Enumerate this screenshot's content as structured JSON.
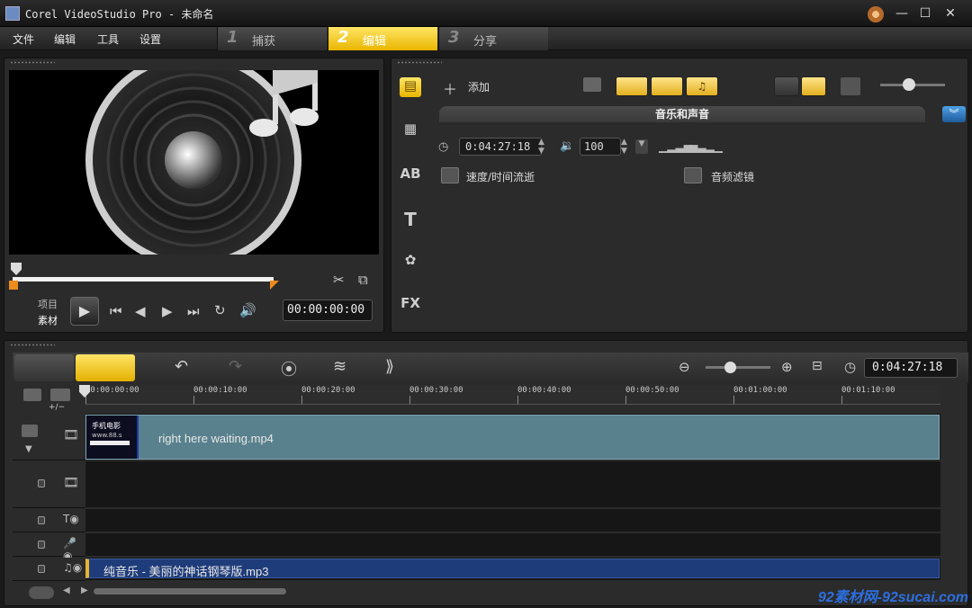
{
  "window": {
    "title": "Corel VideoStudio Pro - 未命名",
    "min": "—",
    "max": "☐",
    "close": "✕"
  },
  "menu": [
    "文件",
    "编辑",
    "工具",
    "设置"
  ],
  "steps": [
    {
      "num": "1",
      "label": "捕获"
    },
    {
      "num": "2",
      "label": "编辑"
    },
    {
      "num": "3",
      "label": "分享"
    }
  ],
  "preview": {
    "mode_project": "项目",
    "mode_clip": "素材",
    "timecode": "00:00:00:00"
  },
  "library": {
    "add_label": "添加",
    "header": "音乐和声音",
    "duration": "0:04:27:18",
    "volume": "100",
    "options": [
      "速度/时间流逝",
      "音频滤镜"
    ]
  },
  "timeline": {
    "timecode": "0:04:27:18",
    "ruler": [
      "00:00:00:00",
      "00:00:10:00",
      "00:00:20:00",
      "00:00:30:00",
      "00:00:40:00",
      "00:00:50:00",
      "00:01:00:00",
      "00:01:10:00"
    ],
    "video_clip": "right here waiting.mp4",
    "audio_clip": "纯音乐 - 美丽的神话钢琴版.mp3",
    "thumb_lines": [
      "手机电影",
      "www.88.s"
    ],
    "add_remove": "+/−"
  },
  "watermark": "92素材网-92sucai.com",
  "colors": {
    "accent": "#f0c21a",
    "video_clip": "#58818d",
    "audio_clip": "#1f3c7a",
    "expand_btn": "#2f7dc8"
  }
}
